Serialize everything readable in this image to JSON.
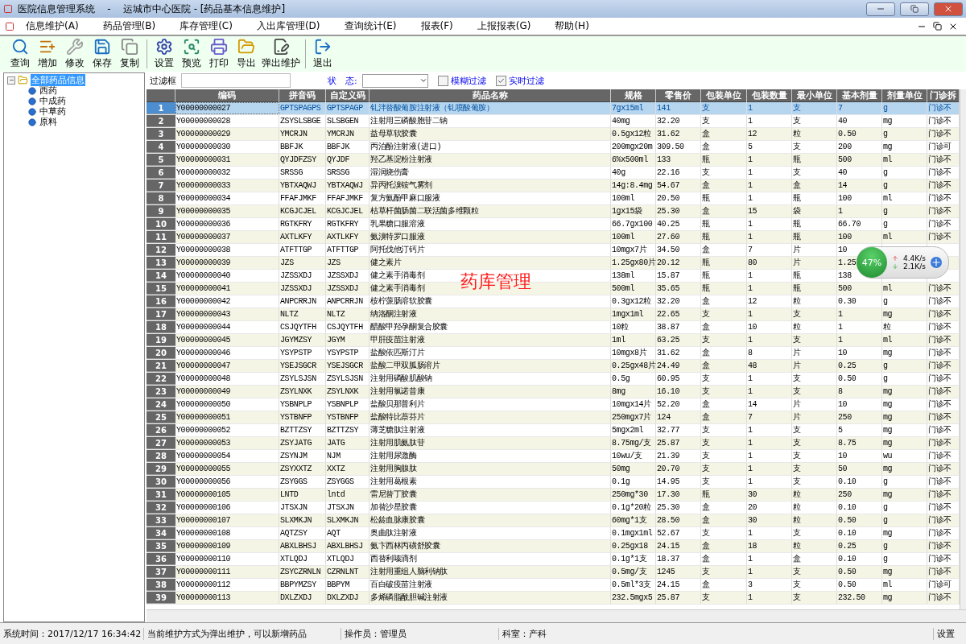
{
  "window": {
    "title": "医院信息管理系统    -    运城市中心医院 - [药品基本信息维护]"
  },
  "menu": [
    "信息维护(A)",
    "药品管理(B)",
    "库存管理(C)",
    "入出库管理(D)",
    "查询统计(E)",
    "报表(F)",
    "上报报表(G)",
    "帮助(H)"
  ],
  "toolbar": [
    [
      {
        "label": "查询"
      },
      {
        "label": "增加"
      },
      {
        "label": "修改"
      },
      {
        "label": "保存"
      },
      {
        "label": "复制"
      }
    ],
    [
      {
        "label": "设置"
      },
      {
        "label": "预览"
      },
      {
        "label": "打印"
      },
      {
        "label": "导出"
      },
      {
        "label": "弹出维护"
      }
    ],
    [
      {
        "label": "退出"
      }
    ]
  ],
  "tree": {
    "label": "全部药品信息",
    "selected": true,
    "expanded": true,
    "children": [
      {
        "label": "西药"
      },
      {
        "label": "中成药"
      },
      {
        "label": "中草药"
      },
      {
        "label": "原料"
      }
    ]
  },
  "filter": {
    "label": "过滤框",
    "status_label": "状　态:",
    "options": [
      {
        "label": "模糊过滤",
        "checked": false
      },
      {
        "label": "实时过滤",
        "checked": true
      }
    ]
  },
  "table": {
    "columns": [
      "编码",
      "拼音码",
      "自定义码",
      "药品名称",
      "规格",
      "零售价",
      "包装单位",
      "包装数量",
      "最小单位",
      "基本剂量",
      "剂量单位",
      "门诊拆"
    ],
    "rows": [
      {
        "n": "1",
        "selected": true,
        "cells": [
          "Y00000000027",
          "GPTSPAGPS",
          "GPTSPAGP",
          "钆泮替酸葡胺注射液（钆喷酸葡胺）",
          "7gx15ml",
          "141",
          "支",
          "1",
          "支",
          "7",
          "g",
          "门诊不"
        ]
      },
      {
        "n": "2",
        "selected": false,
        "cells": [
          "Y00000000028",
          "ZSYSLSBGE",
          "SLSBGEN",
          "注射用三磷酸胞苷二钠",
          "40mg",
          "32.20",
          "支",
          "1",
          "支",
          "40",
          "mg",
          "门诊不"
        ]
      },
      {
        "n": "3",
        "selected": false,
        "cells": [
          "Y00000000029",
          "YMCRJN",
          "YMCRJN",
          "益母草软胶囊",
          "0.5gx12粒",
          "31.62",
          "盒",
          "12",
          "粒",
          "0.50",
          "g",
          "门诊不"
        ]
      },
      {
        "n": "4",
        "selected": false,
        "cells": [
          "Y00000000030",
          "BBFJK",
          "BBFJK",
          "丙泊酚注射液(进口)",
          "200mgx20m",
          "309.50",
          "盒",
          "5",
          "支",
          "200",
          "mg",
          "门诊可"
        ]
      },
      {
        "n": "5",
        "selected": false,
        "cells": [
          "Y00000000031",
          "QYJDFZSY",
          "QYJDF",
          "羟乙基淀粉注射液",
          "6%x500ml",
          "133",
          "瓶",
          "1",
          "瓶",
          "500",
          "ml",
          "门诊不"
        ]
      },
      {
        "n": "6",
        "selected": false,
        "cells": [
          "Y00000000032",
          "SRSSG",
          "SRSSG",
          "湿润烧伤膏",
          "40g",
          "22.16",
          "支",
          "1",
          "支",
          "40",
          "g",
          "门诊不"
        ]
      },
      {
        "n": "7",
        "selected": false,
        "cells": [
          "Y00000000033",
          "YBTXAQWJ",
          "YBTXAQWJ",
          "异丙托溴铵气雾剂",
          "14g:8.4mg",
          "54.67",
          "盒",
          "1",
          "盒",
          "14",
          "g",
          "门诊不"
        ]
      },
      {
        "n": "8",
        "selected": false,
        "cells": [
          "Y00000000034",
          "FFAFJMKF",
          "FFAFJMKF",
          "复方氨酚甲麻口服液",
          "100ml",
          "20.50",
          "瓶",
          "1",
          "瓶",
          "100",
          "ml",
          "门诊不"
        ]
      },
      {
        "n": "9",
        "selected": false,
        "cells": [
          "Y00000000035",
          "KCGJCJEL",
          "KCGJCJEL",
          "枯草杆菌肠菌二联活菌多维颗粒",
          "1gx15袋",
          "25.30",
          "盒",
          "15",
          "袋",
          "1",
          "g",
          "门诊不"
        ]
      },
      {
        "n": "10",
        "selected": false,
        "cells": [
          "Y00000000036",
          "RGTKFRY",
          "RGTKFRY",
          "乳果糖口服溶液",
          "66.7gx100",
          "40.25",
          "瓶",
          "1",
          "瓶",
          "66.70",
          "g",
          "门诊不"
        ]
      },
      {
        "n": "11",
        "selected": false,
        "cells": [
          "Y00000000037",
          "AXTLKFY",
          "AXTLKFY",
          "氨溴特罗口服液",
          "100ml",
          "27.60",
          "瓶",
          "1",
          "瓶",
          "100",
          "ml",
          "门诊不"
        ]
      },
      {
        "n": "12",
        "selected": false,
        "cells": [
          "Y00000000038",
          "ATFTTGP",
          "ATFTTGP",
          "阿托伐他汀钙片",
          "10mgx7片",
          "34.50",
          "盒",
          "7",
          "片",
          "10",
          null,
          null
        ]
      },
      {
        "n": "13",
        "selected": false,
        "cells": [
          "Y00000000039",
          "JZS",
          "JZS",
          "健之素片",
          "1.25gx80片",
          "20.12",
          "瓶",
          "80",
          "片",
          "1.25",
          null,
          null
        ]
      },
      {
        "n": "14",
        "selected": false,
        "cells": [
          "Y00000000040",
          "JZSSXDJ",
          "JZSSXDJ",
          "健之素手消毒剂",
          "138ml",
          "15.87",
          "瓶",
          "1",
          "瓶",
          "138",
          null,
          null
        ]
      },
      {
        "n": "15",
        "selected": false,
        "cells": [
          "Y00000000041",
          "JZSSXDJ",
          "JZSSXDJ",
          "健之素手消毒剂",
          "500ml",
          "35.65",
          "瓶",
          "1",
          "瓶",
          "500",
          "ml",
          "门诊不"
        ]
      },
      {
        "n": "16",
        "selected": false,
        "cells": [
          "Y00000000042",
          "ANPCRRJN",
          "ANPCRRJN",
          "桉柠蒎肠溶软胶囊",
          "0.3gx12粒",
          "32.20",
          "盒",
          "12",
          "粒",
          "0.30",
          "g",
          "门诊不"
        ]
      },
      {
        "n": "17",
        "selected": false,
        "cells": [
          "Y00000000043",
          "NLTZ",
          "NLTZ",
          "纳洛酮注射液",
          "1mgx1ml",
          "22.65",
          "支",
          "1",
          "支",
          "1",
          "mg",
          "门诊不"
        ]
      },
      {
        "n": "18",
        "selected": false,
        "cells": [
          "Y00000000044",
          "CSJQYTFH",
          "CSJQYTFH",
          "醋酸甲羟孕酮复合胶囊",
          "10粒",
          "38.87",
          "盒",
          "10",
          "粒",
          "1",
          "粒",
          "门诊不"
        ]
      },
      {
        "n": "19",
        "selected": false,
        "cells": [
          "Y00000000045",
          "JGYMZSY",
          "JGYM",
          "甲肝疫苗注射液",
          "1ml",
          "63.25",
          "支",
          "1",
          "支",
          "1",
          "ml",
          "门诊不"
        ]
      },
      {
        "n": "20",
        "selected": false,
        "cells": [
          "Y00000000046",
          "YSYPSTP",
          "YSYPSTP",
          "盐酸依匹斯汀片",
          "10mgx8片",
          "31.62",
          "盒",
          "8",
          "片",
          "10",
          "mg",
          "门诊不"
        ]
      },
      {
        "n": "21",
        "selected": false,
        "cells": [
          "Y00000000047",
          "YSEJSGCR",
          "YSEJSGCR",
          "盐酸二甲双胍肠溶片",
          "0.25gx48片",
          "24.49",
          "盒",
          "48",
          "片",
          "0.25",
          "g",
          "门诊不"
        ]
      },
      {
        "n": "22",
        "selected": false,
        "cells": [
          "Y00000000048",
          "ZSYLSJSN",
          "ZSYLSJSN",
          "注射用磷酸肌酸钠",
          "0.5g",
          "60.95",
          "支",
          "1",
          "支",
          "0.50",
          "g",
          "门诊不"
        ]
      },
      {
        "n": "23",
        "selected": false,
        "cells": [
          "Y00000000049",
          "ZSYLNXK",
          "ZSYLNXK",
          "注射用氯诺昔康",
          "8mg",
          "16.10",
          "支",
          "1",
          "支",
          "8",
          "mg",
          "门诊不"
        ]
      },
      {
        "n": "24",
        "selected": false,
        "cells": [
          "Y00000000050",
          "YSBNPLP",
          "YSBNPLP",
          "盐酸贝那普利片",
          "10mgx14片",
          "52.20",
          "盒",
          "14",
          "片",
          "10",
          "mg",
          "门诊不"
        ]
      },
      {
        "n": "25",
        "selected": false,
        "cells": [
          "Y00000000051",
          "YSTBNFP",
          "YSTBNFP",
          "盐酸特比萘芬片",
          "250mgx7片",
          "124",
          "盒",
          "7",
          "片",
          "250",
          "mg",
          "门诊不"
        ]
      },
      {
        "n": "26",
        "selected": false,
        "cells": [
          "Y00000000052",
          "BZTTZSY",
          "BZTTZSY",
          "薄芝糖肽注射液",
          "5mgx2ml",
          "32.77",
          "支",
          "1",
          "支",
          "5",
          "mg",
          "门诊不"
        ]
      },
      {
        "n": "27",
        "selected": false,
        "cells": [
          "Y00000000053",
          "ZSYJATG",
          "JATG",
          "注射用肌氨肽苷",
          "8.75mg/支",
          "25.87",
          "支",
          "1",
          "支",
          "8.75",
          "mg",
          "门诊不"
        ]
      },
      {
        "n": "28",
        "selected": false,
        "cells": [
          "Y00000000054",
          "ZSYNJM",
          "NJM",
          "注射用尿激酶",
          "10wu/支",
          "21.39",
          "支",
          "1",
          "支",
          "10",
          "wu",
          "门诊不"
        ]
      },
      {
        "n": "29",
        "selected": false,
        "cells": [
          "Y00000000055",
          "ZSYXXTZ",
          "XXTZ",
          "注射用胸腺肽",
          "50mg",
          "20.70",
          "支",
          "1",
          "支",
          "50",
          "mg",
          "门诊不"
        ]
      },
      {
        "n": "30",
        "selected": false,
        "cells": [
          "Y00000000056",
          "ZSYGGS",
          "ZSYGGS",
          "注射用葛根素",
          "0.1g",
          "14.95",
          "支",
          "1",
          "支",
          "0.10",
          "g",
          "门诊不"
        ]
      },
      {
        "n": "31",
        "selected": false,
        "cells": [
          "Y00000000105",
          "LNTD",
          "lntd",
          "雷尼替丁胶囊",
          "250mg*30",
          "17.30",
          "瓶",
          "30",
          "粒",
          "250",
          "mg",
          "门诊不"
        ]
      },
      {
        "n": "32",
        "selected": false,
        "cells": [
          "Y00000000106",
          "JTSXJN",
          "JTSXJN",
          "加替沙星胶囊",
          "0.1g*20粒",
          "25.30",
          "盒",
          "20",
          "粒",
          "0.10",
          "g",
          "门诊不"
        ]
      },
      {
        "n": "33",
        "selected": false,
        "cells": [
          "Y00000000107",
          "SLXMKJN",
          "SLXMKJN",
          "松龄血脉康胶囊",
          "60mg*1支",
          "28.50",
          "盒",
          "30",
          "粒",
          "0.50",
          "g",
          "门诊不"
        ]
      },
      {
        "n": "34",
        "selected": false,
        "cells": [
          "Y00000000108",
          "AQTZSY",
          "AQT",
          "奥曲肽注射液",
          "0.1mgx1ml",
          "52.67",
          "支",
          "1",
          "支",
          "0.10",
          "mg",
          "门诊不"
        ]
      },
      {
        "n": "35",
        "selected": false,
        "cells": [
          "Y00000000109",
          "ABXLBHSJ",
          "ABXLBHSJ",
          "氨卞西林丙磺舒胶囊",
          "0.25gx18",
          "24.15",
          "盒",
          "18",
          "粒",
          "0.25",
          "g",
          "门诊不"
        ]
      },
      {
        "n": "36",
        "selected": false,
        "cells": [
          "Y00000000110",
          "XTLQDJ",
          "XTLQDJ",
          "西替利嗪滴剂",
          "0.1g*1支",
          "18.37",
          "盒",
          "1",
          "盒",
          "0.10",
          "g",
          "门诊不"
        ]
      },
      {
        "n": "37",
        "selected": false,
        "cells": [
          "Y00000000111",
          "ZSYCZRNLN",
          "CZRNLNT",
          "注射用重组人脑利钠肽",
          "0.5mg/支",
          "1245",
          "支",
          "1",
          "支",
          "0.50",
          "mg",
          "门诊不"
        ]
      },
      {
        "n": "38",
        "selected": false,
        "cells": [
          "Y00000000112",
          "BBPYMZSY",
          "BBPYM",
          "百白破疫苗注射液",
          "0.5ml*3支",
          "24.15",
          "盒",
          "3",
          "支",
          "0.50",
          "ml",
          "门诊可"
        ]
      },
      {
        "n": "39",
        "selected": false,
        "cells": [
          "Y00000000113",
          "DXLZXDJ",
          "DXLZXDJ",
          "多烯磷脂酰胆碱注射液",
          "232.5mgx5",
          "25.87",
          "支",
          "1",
          "支",
          "232.50",
          "mg",
          "门诊不"
        ]
      }
    ]
  },
  "overlay_text": "药库管理",
  "net_widget": {
    "percent": "47%",
    "up": "4.4K/s",
    "down": "2.1K/s"
  },
  "status_bar": [
    "系统时间：2017/12/17 16:34:42",
    "当前维护方式为弹出维护，可以新增药品",
    "操作员：管理员",
    "科室：产科",
    "设置"
  ]
}
